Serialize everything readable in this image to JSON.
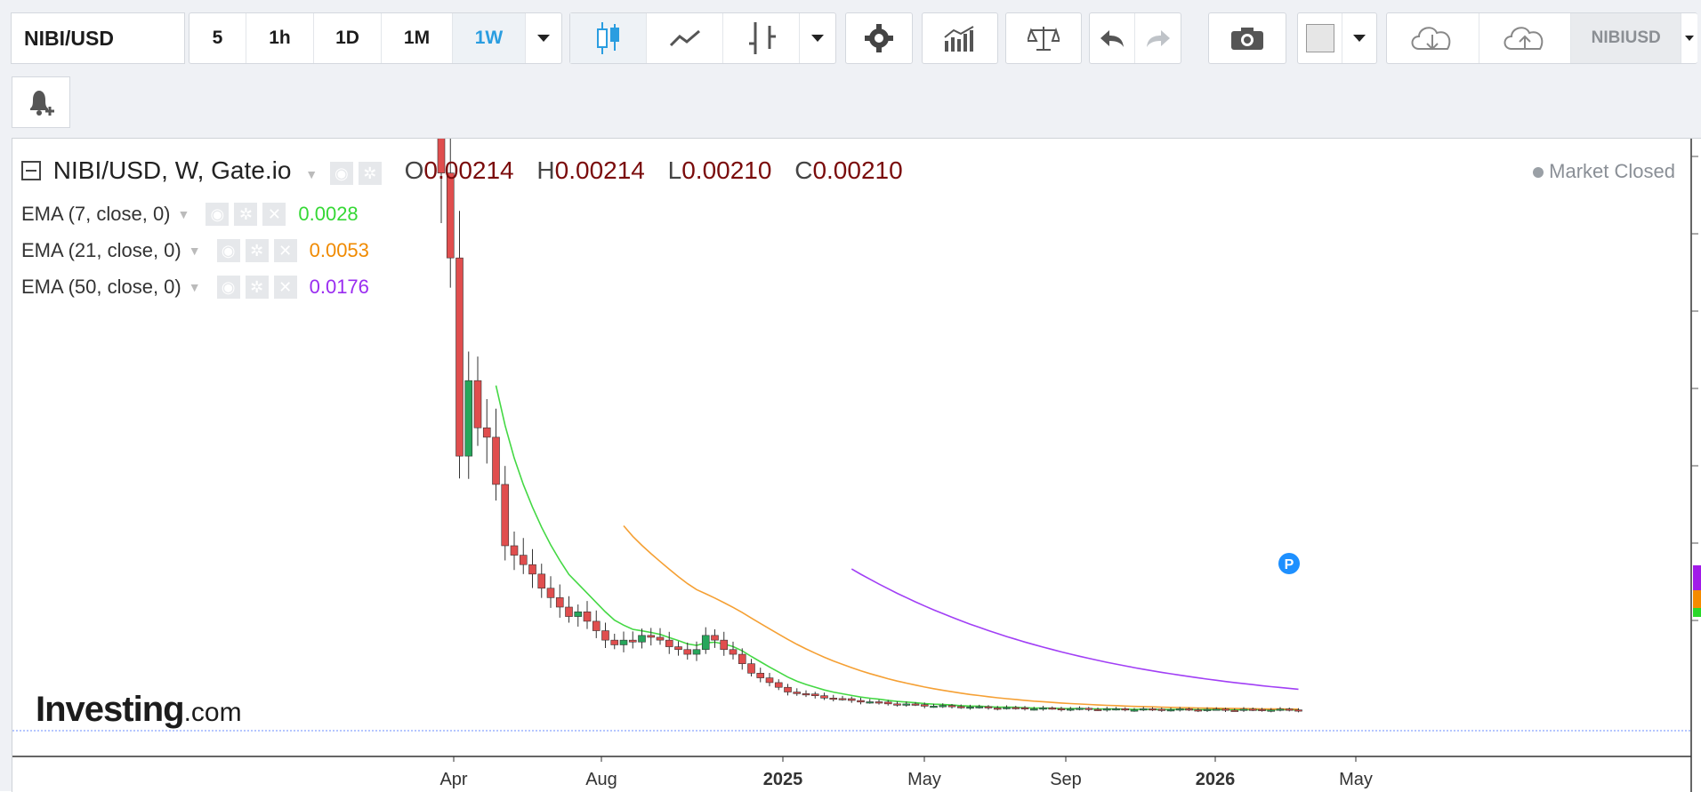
{
  "toolbar": {
    "symbol": "NIBI/USD",
    "intervals": [
      "5",
      "1h",
      "1D",
      "1M",
      "1W"
    ],
    "active_interval": "1W",
    "right_symbol": "NIBIUSD"
  },
  "legend": {
    "title": "NIBI/USD, W, Gate.io",
    "o_label": "O",
    "o_value": "0.00214",
    "h_label": "H",
    "h_value": "0.00214",
    "l_label": "L",
    "l_value": "0.00210",
    "c_label": "C",
    "c_value": "0.00210",
    "ema7_label": "EMA (7, close, 0)",
    "ema7_value": "0.0028",
    "ema21_label": "EMA (21, close, 0)",
    "ema21_value": "0.0053",
    "ema50_label": "EMA (50, close, 0)",
    "ema50_value": "0.0176"
  },
  "status": {
    "market": "Market Closed"
  },
  "logo": {
    "main": "Investing",
    "suffix": ".com"
  },
  "badge": {
    "letter": "P"
  },
  "colors": {
    "up": "#26a65b",
    "down": "#e04e4e",
    "ema7": "#44d844",
    "ema21": "#f5a034",
    "ema50": "#a13ff5"
  },
  "chart_data": {
    "type": "candlestick",
    "title": "NIBI/USD, W, Gate.io",
    "x_tick_labels": [
      "Apr",
      "Aug",
      "2025",
      "May",
      "Sep",
      "2026",
      "May"
    ],
    "candles_approx_close": [
      0.059,
      0.05,
      0.029,
      0.037,
      0.032,
      0.031,
      0.026,
      0.0195,
      0.0185,
      0.0175,
      0.0165,
      0.015,
      0.014,
      0.013,
      0.012,
      0.0125,
      0.0115,
      0.0105,
      0.0095,
      0.009,
      0.0095,
      0.0093,
      0.01,
      0.0098,
      0.0095,
      0.0088,
      0.0085,
      0.008,
      0.0085,
      0.01,
      0.0095,
      0.0085,
      0.008,
      0.007,
      0.006,
      0.0055,
      0.005,
      0.0045,
      0.004
    ],
    "series": [
      {
        "name": "EMA (7, close, 0)",
        "last": 0.0028
      },
      {
        "name": "EMA (21, close, 0)",
        "last": 0.0053
      },
      {
        "name": "EMA (50, close, 0)",
        "last": 0.0176
      }
    ],
    "last_ohlc": {
      "open": 0.00214,
      "high": 0.00214,
      "low": 0.0021,
      "close": 0.0021
    }
  }
}
